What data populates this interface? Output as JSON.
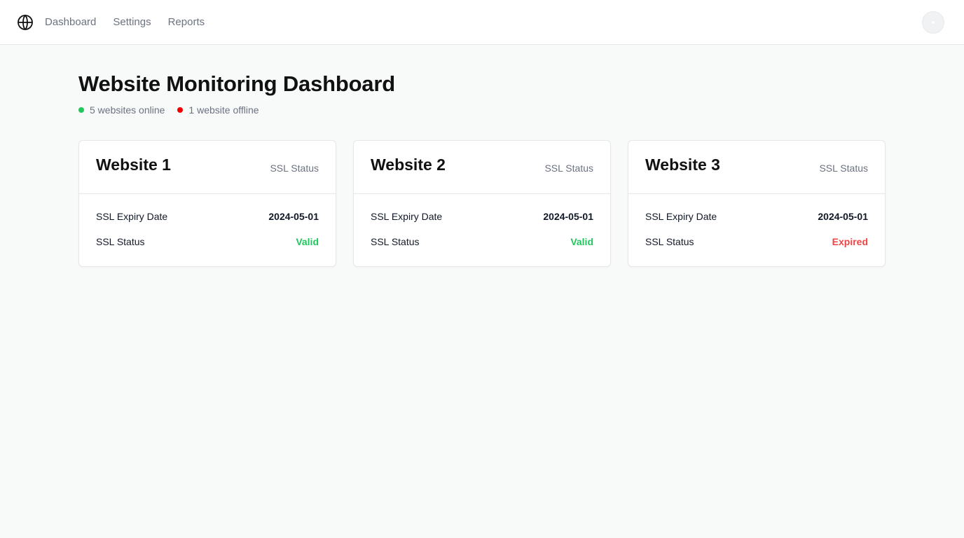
{
  "nav": {
    "items": [
      "Dashboard",
      "Settings",
      "Reports"
    ]
  },
  "page": {
    "title": "Website Monitoring Dashboard",
    "online_text": "5 websites online",
    "offline_text": "1 website offline"
  },
  "colors": {
    "online": "#22c55e",
    "offline": "#ef0000",
    "valid": "#22c55e",
    "expired": "#ef4444"
  },
  "icons": {
    "logo": "globe-icon",
    "avatar": "user-avatar"
  },
  "cards": [
    {
      "title": "Website 1",
      "subtitle": "SSL Status",
      "expiry_label": "SSL Expiry Date",
      "expiry_value": "2024-05-01",
      "status_label": "SSL Status",
      "status_value": "Valid",
      "status_color": "#22c55e"
    },
    {
      "title": "Website 2",
      "subtitle": "SSL Status",
      "expiry_label": "SSL Expiry Date",
      "expiry_value": "2024-05-01",
      "status_label": "SSL Status",
      "status_value": "Valid",
      "status_color": "#22c55e"
    },
    {
      "title": "Website 3",
      "subtitle": "SSL Status",
      "expiry_label": "SSL Expiry Date",
      "expiry_value": "2024-05-01",
      "status_label": "SSL Status",
      "status_value": "Expired",
      "status_color": "#ef4444"
    }
  ]
}
